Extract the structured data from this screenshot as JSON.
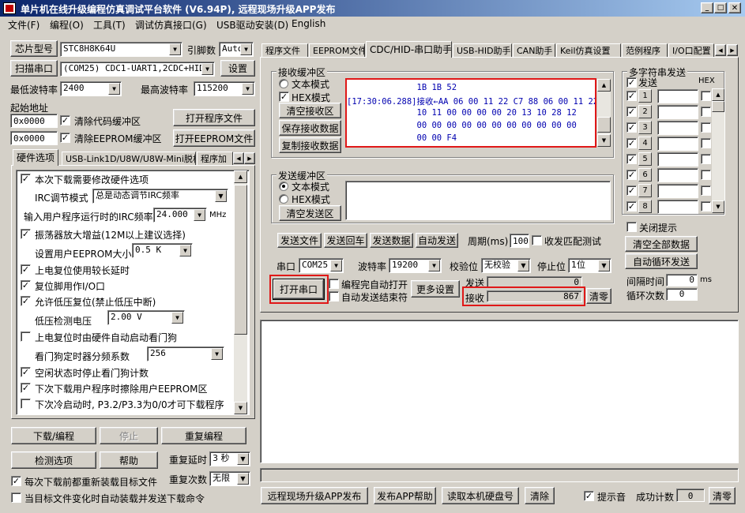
{
  "window": {
    "title": "单片机在线升级编程仿真调试平台软件 (V6.94P), 远程现场升级APP发布"
  },
  "menu": [
    "文件(F)",
    "编程(O)",
    "工具(T)",
    "调试仿真接口(G)",
    "USB驱动安装(D)",
    "English"
  ],
  "left": {
    "chip_btn": "芯片型号",
    "chip_value": "STC8H8K64U",
    "pin_label": "引脚数",
    "pin_value": "Auto",
    "scan_btn": "扫描串口",
    "port_value": "(COM25) CDC1-UART1,2CDC+HID",
    "settings_btn": "设置",
    "min_baud_label": "最低波特率",
    "min_baud": "2400",
    "max_baud_label": "最高波特率",
    "max_baud": "115200",
    "start_addr_label": "起始地址",
    "addr1": "0x0000",
    "clear_code": "清除代码缓冲区",
    "open_prog": "打开程序文件",
    "addr2": "0x0000",
    "clear_eeprom": "清除EEPROM缓冲区",
    "open_eeprom": "打开EEPROM文件",
    "tabs": [
      "硬件选项",
      "USB-Link1D/U8W/U8W-Mini脱机",
      "程序加"
    ],
    "opt_modify": "本次下载需要修改硬件选项",
    "irc_mode_label": "IRC调节模式",
    "irc_mode": "总是动态调节IRC频率",
    "irc_freq_label": "输入用户程序运行时的IRC频率",
    "irc_freq": "24.000",
    "mhz": "MHz",
    "osc_gain": "振荡器放大增益(12M以上建议选择)",
    "eeprom_size_label": "设置用户EEPROM大小",
    "eeprom_size": "0.5 K",
    "por_delay": "上电复位使用较长延时",
    "reset_io": "复位脚用作I/O口",
    "lvr": "允许低压复位(禁止低压中断)",
    "lvd_label": "低压检测电压",
    "lvd_value": "2.00 V",
    "wdt_auto": "上电复位时由硬件自动启动看门狗",
    "wdt_div_label": "看门狗定时器分频系数",
    "wdt_div": "256",
    "idle_wdt": "空闲状态时停止看门狗计数",
    "erase_eeprom": "下次下载用户程序时擦除用户EEPROM区",
    "cold_boot": "下次冷启动时, P3.2/P3.3为0/0才可下载程序",
    "download_btn": "下载/编程",
    "stop_btn": "停止",
    "reprog_btn": "重复编程",
    "detect_btn": "检测选项",
    "help_btn": "帮助",
    "repeat_delay_label": "重复延时",
    "repeat_delay": "3 秒",
    "repeat_count_label": "重复次数",
    "repeat_count": "无限",
    "reload_before": "每次下载前都重新装载目标文件",
    "auto_load": "当目标文件变化时自动装载并发送下载命令"
  },
  "right": {
    "tabs": [
      "程序文件",
      "EEPROM文件",
      "CDC/HID-串口助手",
      "USB-HID助手",
      "CAN助手",
      "Keil仿真设置",
      "范例程序",
      "I/O口配置"
    ],
    "recv": {
      "group": "接收缓冲区",
      "text_mode": "文本模式",
      "hex_mode": "HEX模式",
      "clear_btn": "清空接收区",
      "save_btn": "保存接收数据",
      "copy_btn": "复制接收数据",
      "lines": [
        "              1B 1B 52",
        "[17:30:06.288]接收←AA 06 00 11 22 C7 88 06 00 11 22",
        "              10 11 00 00 00 00 20 13 10 28 12",
        "              00 00 00 00 00 00 00 00 00 00 00",
        "              00 00 F4"
      ]
    },
    "send": {
      "group": "发送缓冲区",
      "text_mode": "文本模式",
      "hex_mode": "HEX模式",
      "clear_btn": "清空发送区",
      "send_file": "发送文件",
      "send_return": "发送回车",
      "send_data": "发送数据",
      "auto_send": "自动发送",
      "period_label": "周期(ms)",
      "period": "100",
      "match_test": "收发匹配测试"
    },
    "port_label": "串口",
    "port": "COM25",
    "baud_label": "波特率",
    "baud": "19200",
    "parity_label": "校验位",
    "parity": "无校验",
    "stop_label": "停止位",
    "stopbits": "1位",
    "open_port_btn": "打开串口",
    "auto_open": "编程完自动打开",
    "auto_send_end": "自动发送结束符",
    "more_btn": "更多设置",
    "send_label": "发送",
    "send_count": "0",
    "recv_label": "接收",
    "recv_count": "867",
    "reset_btn": "清零",
    "multi": {
      "group": "多字符串发送",
      "send_hdr": "发送",
      "hex_hdr": "HEX",
      "nums": [
        "1",
        "2",
        "3",
        "4",
        "5",
        "6",
        "7",
        "8"
      ],
      "close_tip": "关闭提示",
      "clear_all": "清空全部数据",
      "auto_loop": "自动循环发送",
      "interval_label": "间隔时间",
      "interval": "0",
      "ms": "ms",
      "loop_label": "循环次数",
      "loop": "0"
    },
    "bottom": {
      "publish_btn": "远程现场升级APP发布",
      "publish_help": "发布APP帮助",
      "read_disk": "读取本机硬盘号",
      "clear_btn": "清除",
      "beep": "提示音",
      "success_label": "成功计数",
      "success": "0",
      "reset_btn": "清零"
    }
  }
}
